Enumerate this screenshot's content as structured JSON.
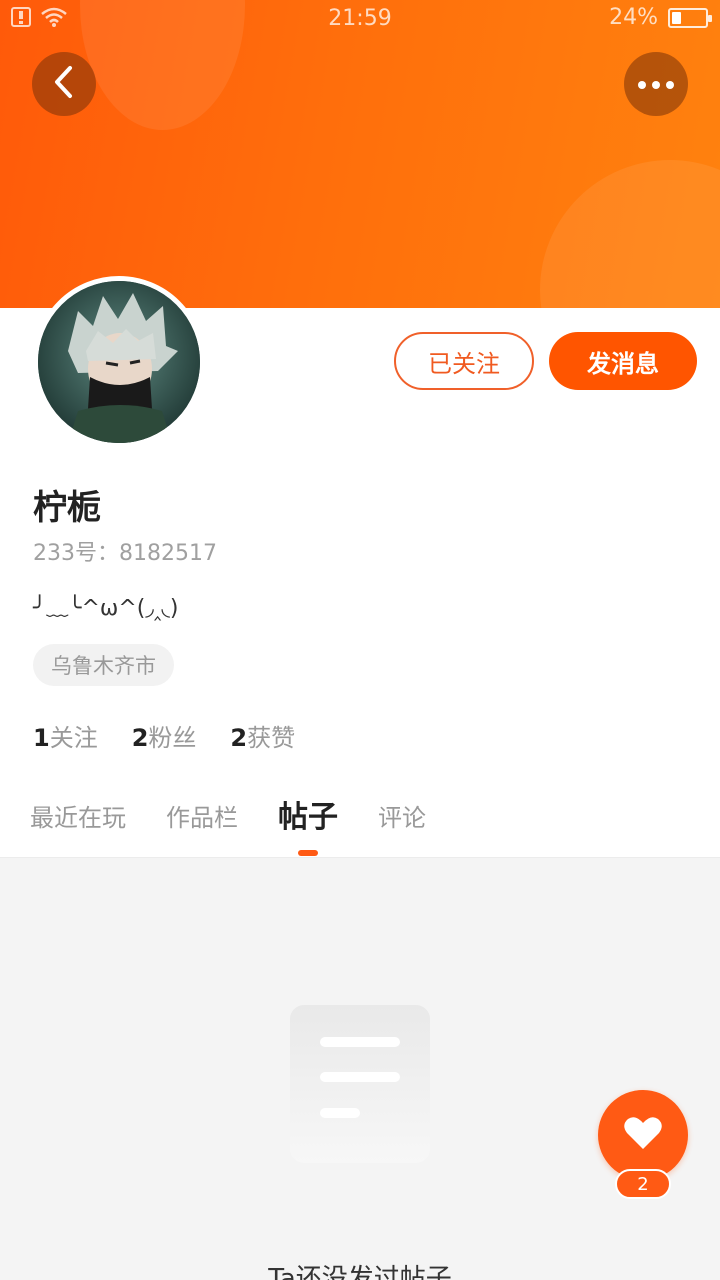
{
  "status_bar": {
    "time": "21:59",
    "battery_percent": "24%",
    "battery_level": 0.24
  },
  "profile": {
    "name": "柠栀",
    "id_text": "233号：8182517",
    "bio": "╯﹏╰^ω^(◞‸◟)",
    "location": "乌鲁木齐市"
  },
  "actions": {
    "following_label": "已关注",
    "message_label": "发消息"
  },
  "stats": [
    {
      "num": "1",
      "label": "关注"
    },
    {
      "num": "2",
      "label": "粉丝"
    },
    {
      "num": "2",
      "label": "获赞"
    }
  ],
  "tabs": [
    {
      "label": "最近在玩",
      "active": false
    },
    {
      "label": "作品栏",
      "active": false
    },
    {
      "label": "帖子",
      "active": true
    },
    {
      "label": "评论",
      "active": false
    }
  ],
  "empty_state": {
    "text": "Ta还没发过帖子"
  },
  "like": {
    "count": "2"
  },
  "icons": {
    "back": "back-arrow-icon",
    "more": "more-dots-icon",
    "heart": "heart-icon",
    "empty": "document-icon"
  },
  "colors": {
    "brand": "#ff5500",
    "header_gradient_start": "#ff5a0a",
    "header_gradient_end": "#ff820e"
  }
}
